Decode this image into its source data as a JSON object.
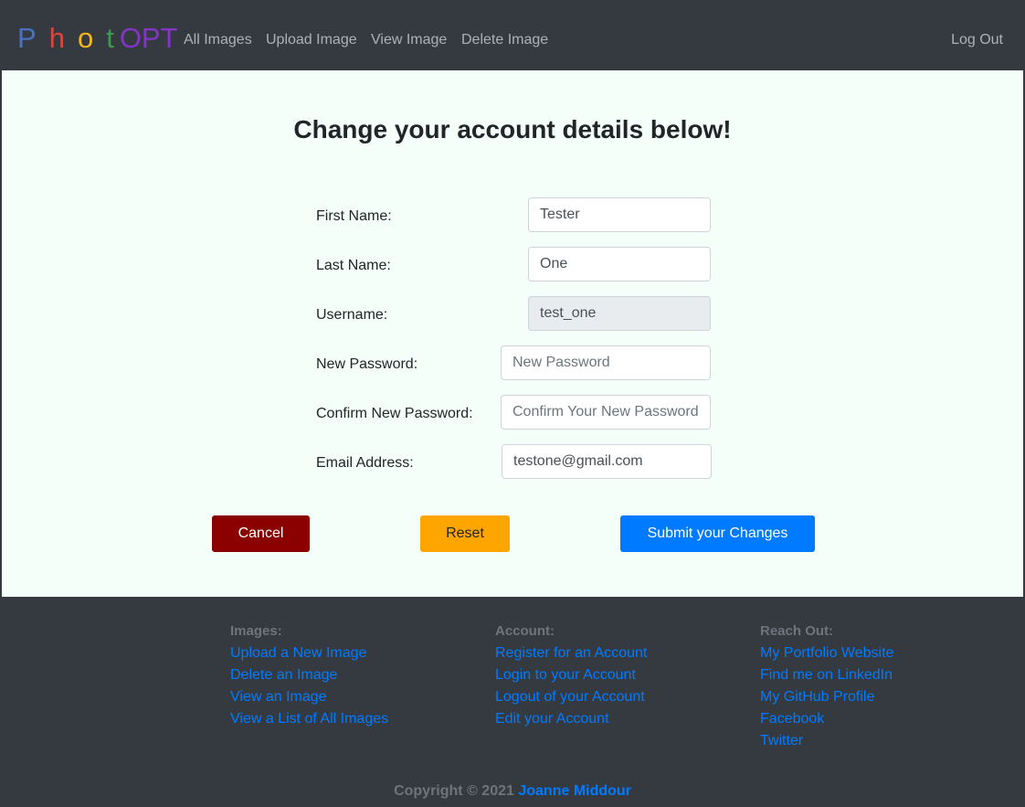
{
  "brand": {
    "letters": [
      {
        "char": "P",
        "color": "#4a72c4"
      },
      {
        "char": "h",
        "color": "#d9463b"
      },
      {
        "char": "o",
        "color": "#f2b71e"
      },
      {
        "char": "t",
        "color": "#3b9b4f"
      },
      {
        "char": "OPT",
        "color": "#8434c7"
      }
    ]
  },
  "nav": {
    "items": [
      "All Images",
      "Upload Image",
      "View Image",
      "Delete Image"
    ],
    "logout": "Log Out"
  },
  "page": {
    "title": "Change your account details below!"
  },
  "form": {
    "first_name": {
      "label": "First Name:",
      "value": "Tester",
      "placeholder": ""
    },
    "last_name": {
      "label": "Last Name:",
      "value": "One",
      "placeholder": ""
    },
    "username": {
      "label": "Username:",
      "value": "test_one",
      "placeholder": ""
    },
    "new_password": {
      "label": "New Password:",
      "value": "",
      "placeholder": "New Password"
    },
    "confirm_password": {
      "label": "Confirm New Password:",
      "value": "",
      "placeholder": "Confirm Your New Password"
    },
    "email": {
      "label": "Email Address:",
      "value": "testone@gmail.com",
      "placeholder": ""
    }
  },
  "buttons": {
    "cancel": "Cancel",
    "reset": "Reset",
    "submit": "Submit your Changes"
  },
  "colors": {
    "cancel_bg": "#8b0000",
    "reset_bg": "#ffa500",
    "submit_bg": "#007bff",
    "main_bg": "#f3fff8",
    "dark_bg": "#343a40",
    "link": "#007bff"
  },
  "footer": {
    "images": {
      "heading": "Images:",
      "links": [
        "Upload a New Image",
        "Delete an Image",
        "View an Image",
        "View a List of All Images"
      ]
    },
    "account": {
      "heading": "Account:",
      "links": [
        "Register for an Account",
        "Login to your Account",
        "Logout of your Account",
        "Edit your Account"
      ]
    },
    "reach_out": {
      "heading": "Reach Out:",
      "links": [
        "My Portfolio Website",
        "Find me on LinkedIn",
        "My GitHub Profile",
        "Facebook",
        "Twitter"
      ]
    },
    "copyright": "Copyright © 2021",
    "author": "Joanne Middour"
  }
}
